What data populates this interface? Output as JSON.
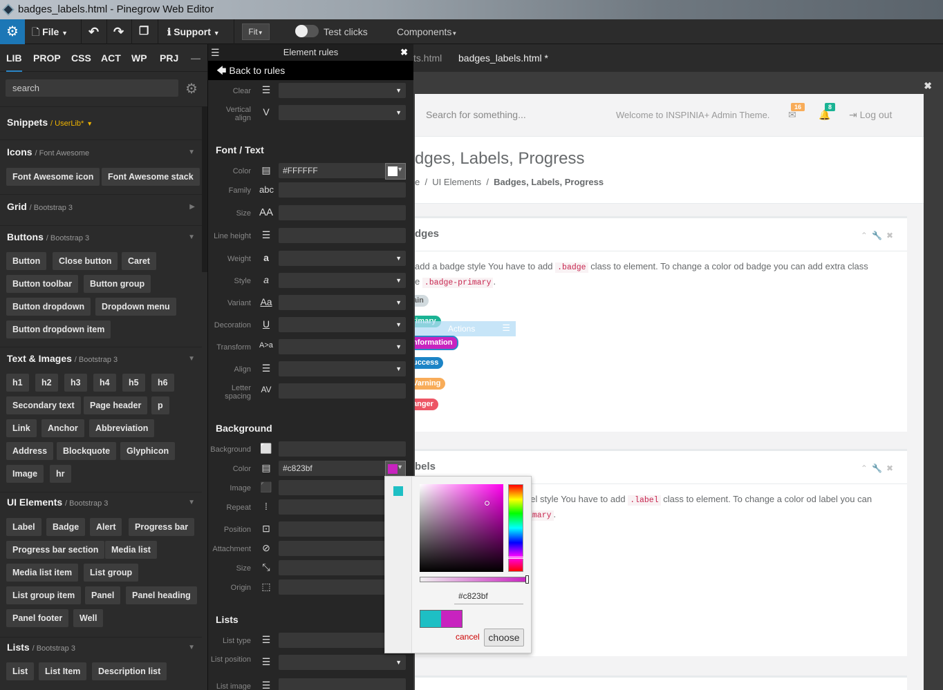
{
  "window": {
    "title": "badges_labels.html - Pinegrow Web Editor"
  },
  "toolbar": {
    "file": "File",
    "support": "Support",
    "fit": "Fit",
    "test_clicks": "Test clicks",
    "components": "Components"
  },
  "left": {
    "tabs": [
      "LIB",
      "PROP",
      "CSS",
      "ACT",
      "WP",
      "PRJ"
    ],
    "active_tab": "LIB",
    "search_placeholder": "search",
    "sections": [
      {
        "title": "Snippets",
        "sub": "/ UserLib*",
        "items": []
      },
      {
        "title": "Icons",
        "sub": "/ Font Awesome",
        "items": [
          "Font Awesome icon",
          "Font Awesome stack"
        ]
      },
      {
        "title": "Grid",
        "sub": "/ Bootstrap 3",
        "items": []
      },
      {
        "title": "Buttons",
        "sub": "/ Bootstrap 3",
        "items": [
          "Button",
          "Close button",
          "Caret",
          "Button toolbar",
          "Button group",
          "Button dropdown",
          "Dropdown menu",
          "Button dropdown item"
        ]
      },
      {
        "title": "Text & Images",
        "sub": "/ Bootstrap 3",
        "items": [
          "h1",
          "h2",
          "h3",
          "h4",
          "h5",
          "h6",
          "Secondary text",
          "Page header",
          "p",
          "Link",
          "Anchor",
          "Abbreviation",
          "Address",
          "Blockquote",
          "Glyphicon",
          "Image",
          "hr"
        ]
      },
      {
        "title": "UI Elements",
        "sub": "/ Bootstrap 3",
        "items": [
          "Label",
          "Badge",
          "Alert",
          "Progress bar",
          "Progress bar section",
          "Media list",
          "Media list item",
          "List group",
          "List group item",
          "Panel",
          "Panel heading",
          "Panel footer",
          "Well"
        ]
      },
      {
        "title": "Lists",
        "sub": "/ Bootstrap 3",
        "items": [
          "List",
          "List Item",
          "Description list"
        ]
      }
    ]
  },
  "rules": {
    "title": "Element rules",
    "back": "Back to rules",
    "font_section": "Font / Text",
    "background_section": "Background",
    "lists_section": "Lists",
    "labels": {
      "clear": "Clear",
      "valign": "Vertical align",
      "color": "Color",
      "family": "Family",
      "size": "Size",
      "line_height": "Line height",
      "weight": "Weight",
      "style": "Style",
      "variant": "Variant",
      "decoration": "Decoration",
      "transform": "Transform",
      "align": "Align",
      "letter_spacing": "Letter spacing",
      "background": "Background",
      "bg_color": "Color",
      "image": "Image",
      "repeat": "Repeat",
      "position": "Position",
      "attachment": "Attachment",
      "bg_size": "Size",
      "origin": "Origin",
      "list_type": "List type",
      "list_position": "List position",
      "list_image": "List image"
    },
    "font_color_value": "#FFFFFF",
    "bg_color_value": "#c823bf",
    "icons": {
      "family": "abc",
      "size": "AA",
      "weight": "a",
      "style": "a",
      "variant": "Aa",
      "decoration": "U",
      "transform": "A>a",
      "letter_spacing": "AV"
    }
  },
  "file_tabs": [
    "ts.html",
    "badges_labels.html *"
  ],
  "page": {
    "search": "Search for something...",
    "welcome": "Welcome to INSPINIA+ Admin Theme.",
    "mail_count": "16",
    "bell_count": "8",
    "logout": "Log out",
    "heading": "dges, Labels, Progress",
    "breadcrumb": [
      "e",
      "UI Elements",
      "Badges, Labels, Progress"
    ],
    "badges_title": "dges",
    "badges_text1": "add a badge style You have to add",
    "badges_code1": ".badge",
    "badges_text2": "class to element. To change a color od badge you can add extra class",
    "badges_text3": "e",
    "badges_code2": ".badge-primary",
    "badges": [
      "ain",
      "rimary",
      "nformation",
      "uccess",
      "Varning",
      "anger"
    ],
    "actions": "Actions",
    "labels_title": "bels",
    "labels_text1": "bel style You have to add",
    "labels_code1": ".label",
    "labels_text2": "class to element. To change a color od label you can",
    "labels_code2": "imary"
  },
  "picker": {
    "hex": "#c823bf",
    "cancel": "cancel",
    "choose": "choose",
    "old_color": "#1ebfc4",
    "new_color": "#c823bf"
  },
  "colors": {
    "accent": "#1c77b6",
    "badge_plain": "#d1dade",
    "badge_primary": "#1ab394",
    "badge_info": "#c823bf",
    "badge_success": "#1c84c6",
    "badge_warning": "#f8ac59",
    "badge_danger": "#ed5565"
  }
}
